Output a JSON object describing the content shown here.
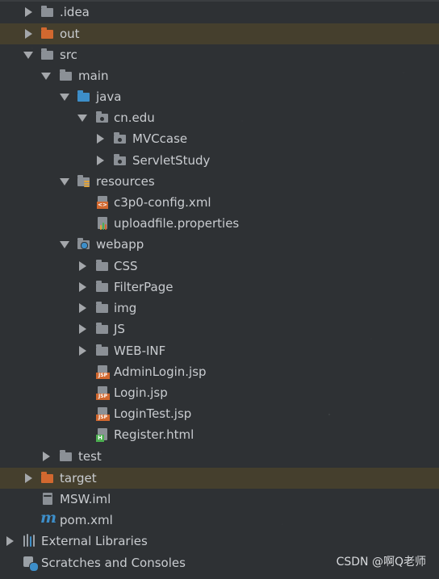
{
  "tree": {
    "rows": [
      {
        "label": ".idea",
        "icon": "folder-icon"
      },
      {
        "label": "out",
        "icon": "excluded-folder-icon"
      },
      {
        "label": "src",
        "icon": "folder-icon"
      },
      {
        "label": "main",
        "icon": "folder-icon"
      },
      {
        "label": "java",
        "icon": "source-root-folder-icon"
      },
      {
        "label": "cn.edu",
        "icon": "package-icon"
      },
      {
        "label": "MVCcase",
        "icon": "package-icon"
      },
      {
        "label": "ServletStudy",
        "icon": "package-icon"
      },
      {
        "label": "resources",
        "icon": "resources-root-folder-icon"
      },
      {
        "label": "c3p0-config.xml",
        "icon": "xml-file-icon"
      },
      {
        "label": "uploadfile.properties",
        "icon": "properties-file-icon"
      },
      {
        "label": "webapp",
        "icon": "web-folder-icon"
      },
      {
        "label": "CSS",
        "icon": "folder-icon"
      },
      {
        "label": "FilterPage",
        "icon": "folder-icon"
      },
      {
        "label": "img",
        "icon": "folder-icon"
      },
      {
        "label": "JS",
        "icon": "folder-icon"
      },
      {
        "label": "WEB-INF",
        "icon": "folder-icon"
      },
      {
        "label": "AdminLogin.jsp",
        "icon": "jsp-file-icon"
      },
      {
        "label": "Login.jsp",
        "icon": "jsp-file-icon"
      },
      {
        "label": "LoginTest.jsp",
        "icon": "jsp-file-icon"
      },
      {
        "label": "Register.html",
        "icon": "html-file-icon"
      },
      {
        "label": "test",
        "icon": "folder-icon"
      },
      {
        "label": "target",
        "icon": "excluded-folder-icon"
      },
      {
        "label": "MSW.iml",
        "icon": "module-file-icon"
      },
      {
        "label": "pom.xml",
        "icon": "maven-file-icon"
      },
      {
        "label": "External Libraries",
        "icon": "libraries-icon"
      },
      {
        "label": "Scratches and Consoles",
        "icon": "scratches-icon"
      }
    ]
  },
  "icon_badges": {
    "jsp": "JSP",
    "html": "H",
    "maven": "m",
    "xml": "<>"
  },
  "watermark": "CSDN @啊Q老师",
  "colors": {
    "folder": "#8b9096",
    "excluded_folder": "#d2682f",
    "source_root": "#3d8ec9",
    "highlight_row": "#5a4b28",
    "text": "#c9ccd0"
  }
}
